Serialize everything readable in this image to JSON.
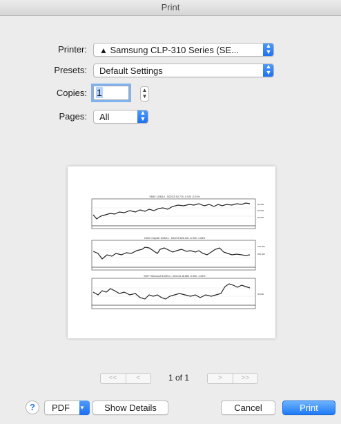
{
  "window": {
    "title": "Print"
  },
  "printer": {
    "label": "Printer:",
    "value": "Samsung CLP-310 Series (SE...",
    "warning_icon": "warning-triangle-icon"
  },
  "presets": {
    "label": "Presets:",
    "value": "Default Settings"
  },
  "copies": {
    "label": "Copies:",
    "value": "1"
  },
  "pages": {
    "label": "Pages:",
    "value": "All"
  },
  "preview": {
    "charts": [
      {
        "header": "EBAY   10/8/14 - 5/22/15     53.720  -0.020  -0.03%"
      },
      {
        "header": "CMG  Chipotle    10/8/14 - 5/22/15     626.440  -6.900  -1.08%"
      },
      {
        "header": "MSFT  Microsoft     10/8/14 - 5/22/15     46.860  -0.500  -1.05%"
      }
    ]
  },
  "navigation": {
    "first": "<<",
    "prev": "<",
    "page_count": "1 of 1",
    "next": ">",
    "last": ">>"
  },
  "buttons": {
    "help": "?",
    "pdf": "PDF",
    "show_details": "Show Details",
    "cancel": "Cancel",
    "print": "Print"
  },
  "colors": {
    "accent": "#1f7bf5",
    "background": "#ececec"
  }
}
